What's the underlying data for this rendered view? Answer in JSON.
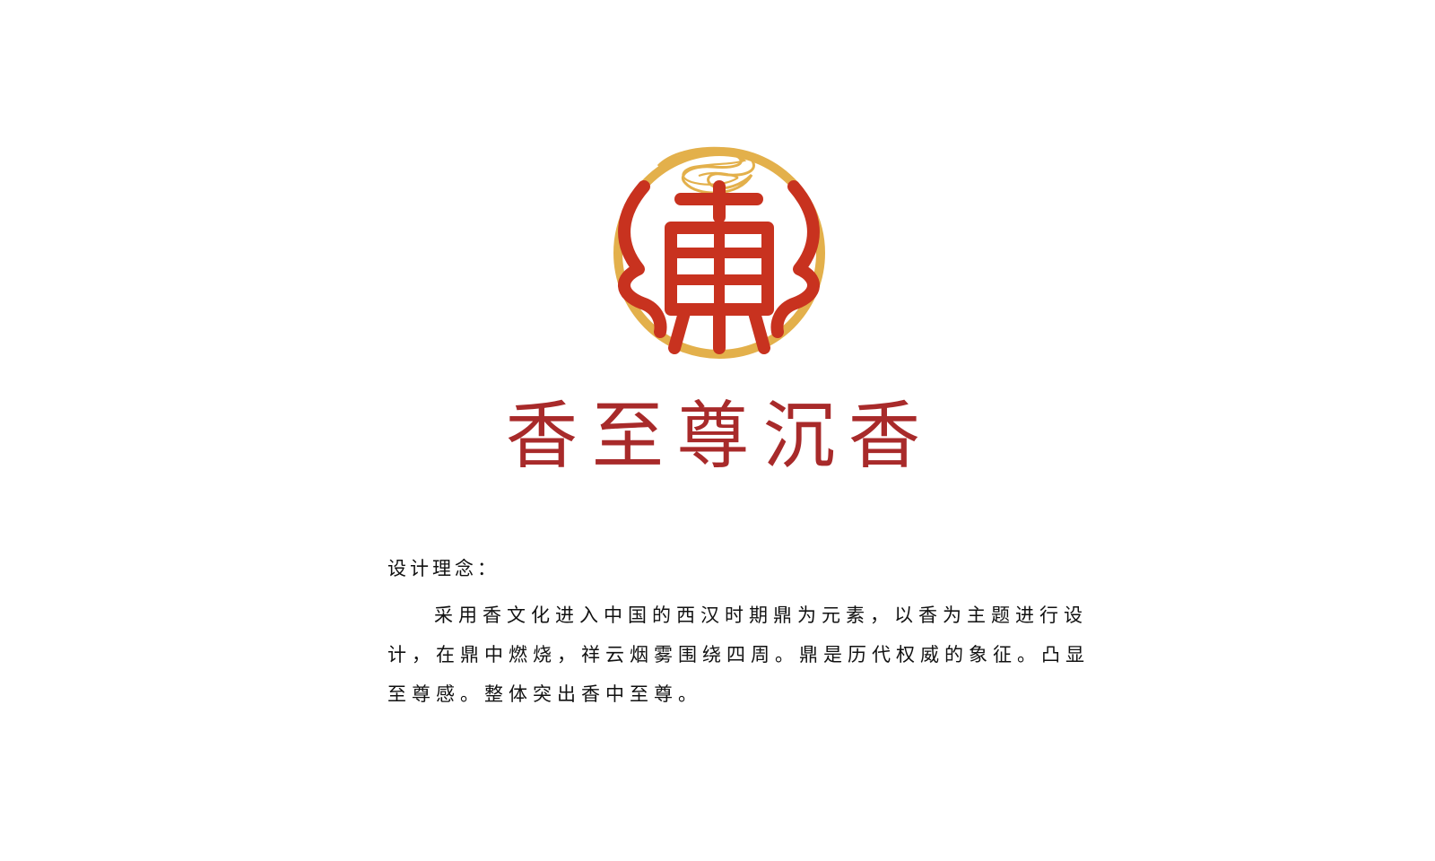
{
  "logo": {
    "brand_name_chars": [
      "香",
      "至",
      "尊",
      "沉",
      "香"
    ],
    "colors": {
      "gold": "#E3B04B",
      "red": "#C8321F",
      "text_red": "#A82A2A"
    },
    "emblem_icon": "incense-cauldron-emblem-icon"
  },
  "design_concept": {
    "title": "设计理念：",
    "body": "采用香文化进入中国的西汉时期鼎为元素，以香为主题进行设计，在鼎中燃烧，祥云烟雾围绕四周。鼎是历代权威的象征。凸显至尊感。整体突出香中至尊。"
  }
}
